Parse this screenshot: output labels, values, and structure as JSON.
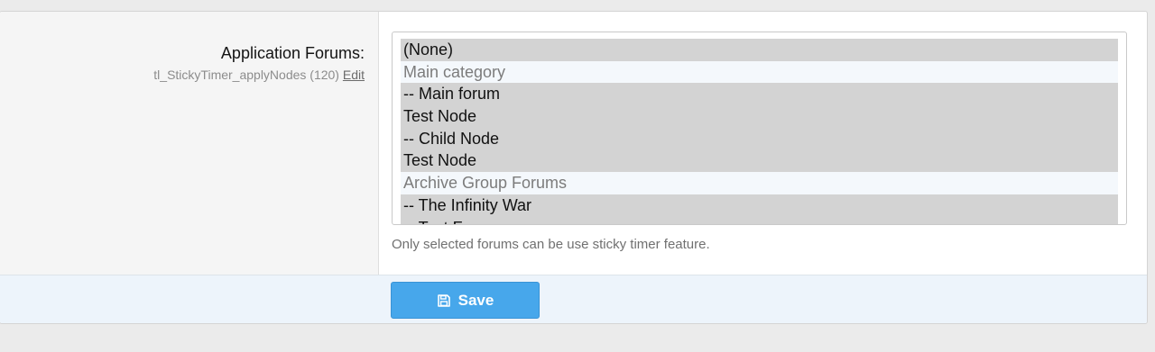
{
  "field": {
    "label": "Application Forums:",
    "hint": "tl_StickyTimer_applyNodes (120)",
    "edit_link": "Edit",
    "explain": "Only selected forums can be use sticky timer feature."
  },
  "listbox": {
    "options": [
      {
        "label": "(None)",
        "selected": true,
        "group": false
      },
      {
        "label": "Main category",
        "selected": false,
        "group": true
      },
      {
        "label": "-- Main forum",
        "selected": true,
        "group": false
      },
      {
        "label": "Test Node",
        "selected": true,
        "group": false
      },
      {
        "label": "-- Child Node",
        "selected": true,
        "group": false
      },
      {
        "label": "Test Node",
        "selected": true,
        "group": false
      },
      {
        "label": "Archive Group Forums",
        "selected": false,
        "group": true
      },
      {
        "label": "-- The Infinity War",
        "selected": true,
        "group": false
      },
      {
        "label": "-- Test Forum",
        "selected": true,
        "group": false
      }
    ]
  },
  "footer": {
    "save_label": "Save",
    "save_icon": "save-icon"
  },
  "colors": {
    "accent": "#47a7eb",
    "selected_bg": "#d3d3d3",
    "footer_bg": "#edf4fb"
  }
}
